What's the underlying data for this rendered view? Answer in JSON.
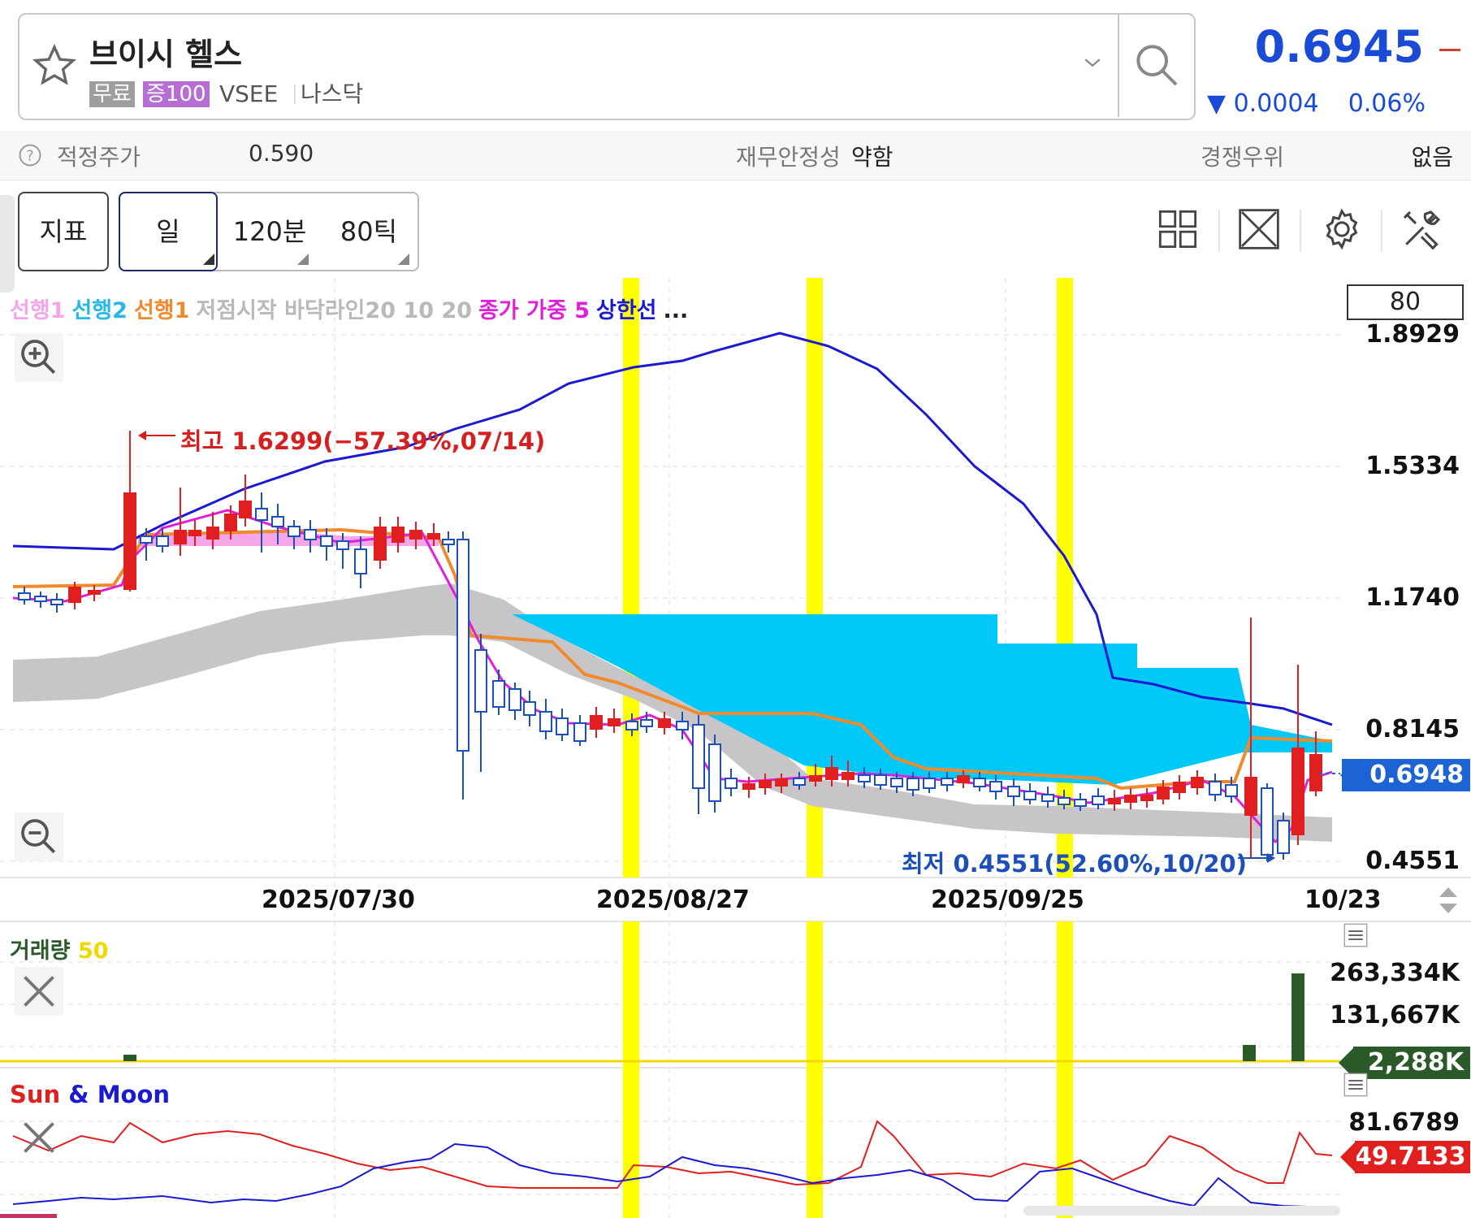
{
  "header": {
    "stock_name": "브이시 헬스",
    "tag_free": "무료",
    "tag_margin": "증100",
    "ticker": "VSEE",
    "market": "나스닥",
    "price": "0.6945",
    "change_value": "▼ 0.0004",
    "change_pct": "0.06%",
    "icons": [
      "star-icon",
      "chevron-down-icon",
      "search-icon"
    ]
  },
  "info": {
    "fair_price_label": "적정주가",
    "fair_price_value": "0.590",
    "stability_label": "재무안정성",
    "stability_value": "약함",
    "competitive_label": "경쟁우위",
    "competitive_value": "없음"
  },
  "toolbar": {
    "indicator_label": "지표",
    "period_day": "일",
    "period_120": "120분",
    "period_tick": "80틱",
    "tools": [
      "grid-layout-icon",
      "expand-icon",
      "gear-icon",
      "tools-icon"
    ]
  },
  "chart": {
    "legend": [
      {
        "text": "선행1",
        "color": "#f4a6e8"
      },
      {
        "text": "선행2",
        "color": "#27b7e8"
      },
      {
        "text": "선행1",
        "color": "#f08a2c"
      },
      {
        "text": "저점시작 바닥라인20 10 20",
        "color": "#b9b9b9"
      },
      {
        "text": "종가 가중 5",
        "color": "#e020d8"
      },
      {
        "text": "상한선",
        "color": "#1a1ad0"
      },
      {
        "text": "...",
        "color": "#222222"
      }
    ],
    "box_value": "80",
    "y_labels": [
      "1.8929",
      "1.5334",
      "1.1740",
      "0.8145",
      "0.4551"
    ],
    "current_price_tag": "0.6948",
    "x_labels": [
      "2025/07/30",
      "2025/08/27",
      "2025/09/25",
      "10/23"
    ],
    "high_annotation": "최고 1.6299(−57.39%,07/14)",
    "low_annotation": "최저 0.4551(52.60%,10/20)"
  },
  "volume": {
    "title_main": "거래량",
    "title_period": "50",
    "y_labels": [
      "263,334K",
      "131,667K"
    ],
    "current_tag": "2,288K"
  },
  "sunmoon": {
    "title_sun": "Sun",
    "title_amp": "&",
    "title_moon": "Moon",
    "y_label": "81.6789",
    "current_tag": "49.7133"
  },
  "colors": {
    "price_blue": "#1a4bd6",
    "up_red": "#e02020",
    "down_blue": "#1c4fb8",
    "cloud_cyan": "#00c8f8",
    "highlight_yellow": "#ffff00"
  }
}
